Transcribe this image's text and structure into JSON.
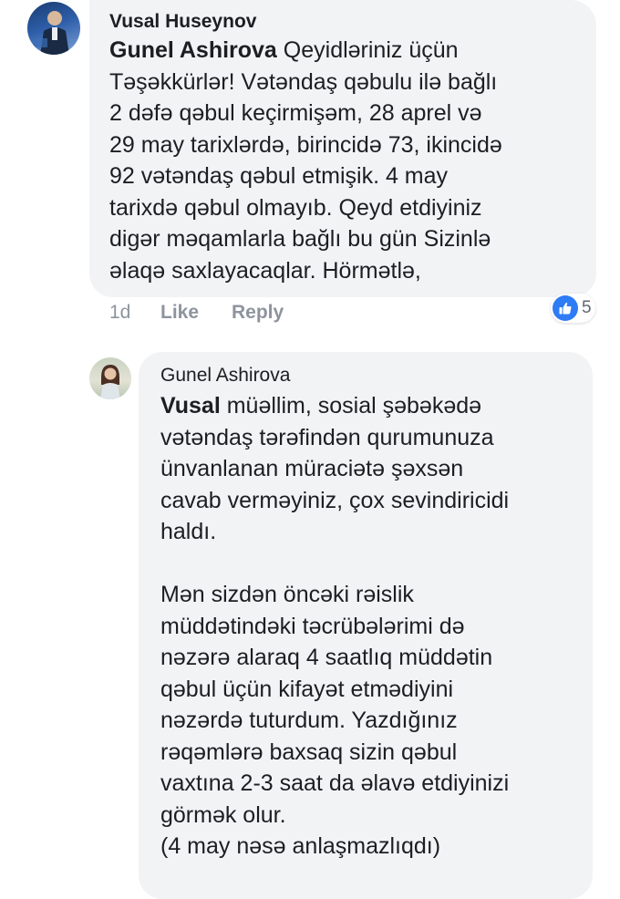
{
  "comment": {
    "author": "Vusal Huseynov",
    "mention": "Gunel Ashirova",
    "text": " Qeyidləriniz üçün\nTəşəkkürlər!  Vətəndaş qəbulu ilə bağlı\n2 dəfə qəbul keçirmişəm, 28 aprel və\n29 may tarixlərdə, birincidə 73, ikincidə\n92 vətəndaş qəbul etmişik. 4 may\ntarixdə qəbul olmayıb. Qeyd etdiyiniz\ndigər məqamlarla bağlı bu gün Sizinlə\nəlaqə saxlayacaqlar. Hörmətlə,",
    "time": "1d",
    "like_label": "Like",
    "reply_label": "Reply",
    "reaction_count": "5",
    "reaction_color": "#2e7bf6"
  },
  "reply": {
    "author": "Gunel Ashirova",
    "mention": "Vusal",
    "text": " müəllim, sosial şəbəkədə\nvətəndaş tərəfindən qurumunuza\nünvanlanan müraciətə şəxsən\ncavab verməyiniz, çox sevindiricidi\nhaldı.\n\nMən sizdən öncəki rəislik\nmüddətindəki təcrübələrimi də\nnəzərə alaraq 4 saatlıq müddətin\nqəbul üçün kifayət etmədiyini\nnəzərdə tuturdum. Yazdığınız\nrəqəmlərə baxsaq sizin qəbul\nvaxtına 2-3 saat da əlavə etdiyinizi\ngörmək olur.\n(4 may nəsə anlaşmazlıqdı)"
  },
  "icons": {
    "avatar_1": "user-avatar-photo",
    "avatar_2": "user-avatar-photo",
    "reaction": "thumbs-up-icon"
  }
}
